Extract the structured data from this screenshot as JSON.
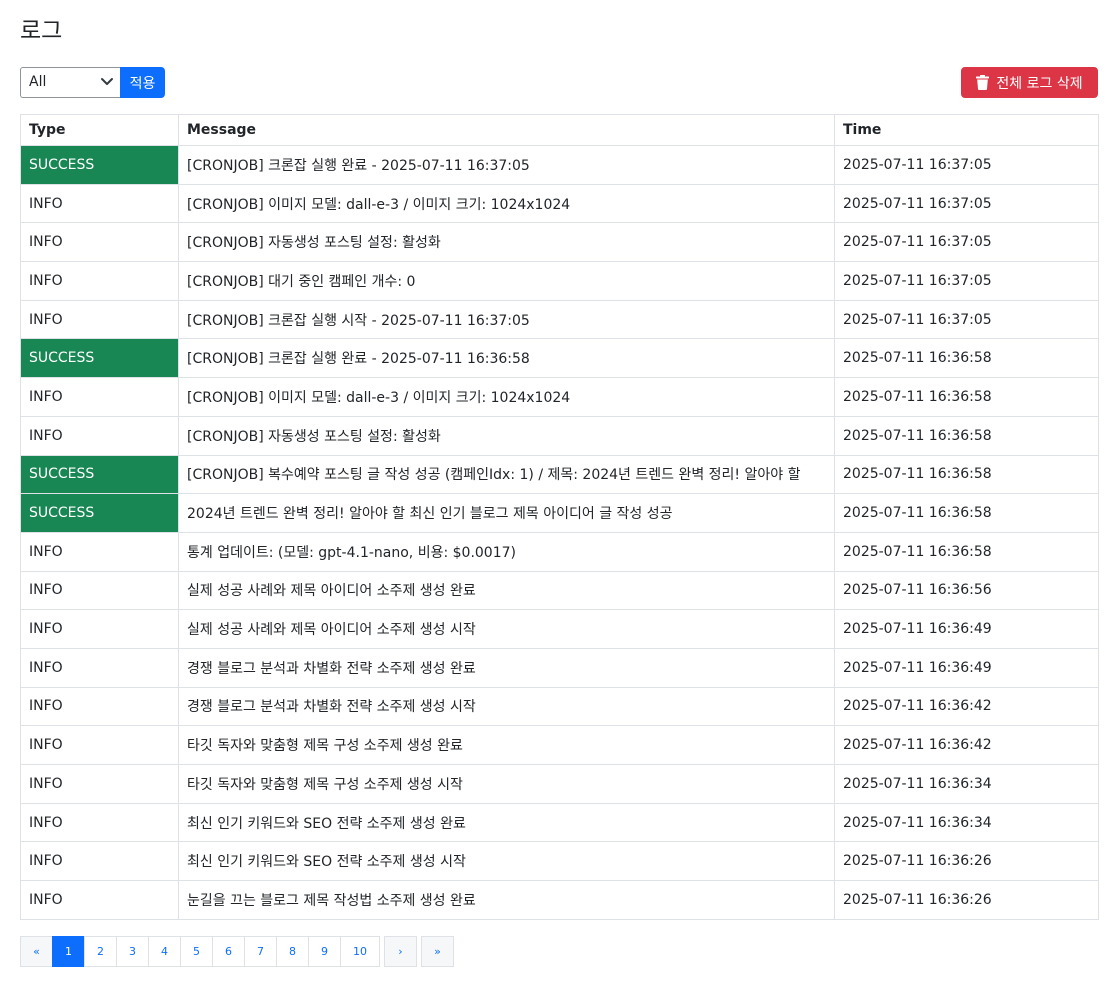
{
  "page": {
    "title": "로그"
  },
  "filter": {
    "selected": "All",
    "apply_label": "적용"
  },
  "actions": {
    "delete_all_label": "전체 로그 삭제",
    "delete_icon": "trash-icon"
  },
  "colors": {
    "primary": "#0d6efd",
    "danger": "#dc3545",
    "success": "#198754"
  },
  "table": {
    "headers": [
      "Type",
      "Message",
      "Time"
    ],
    "rows": [
      {
        "type": "SUCCESS",
        "message": "[CRONJOB] 크론잡 실행 완료 - 2025-07-11 16:37:05",
        "time": "2025-07-11 16:37:05"
      },
      {
        "type": "INFO",
        "message": "[CRONJOB] 이미지 모델: dall-e-3 / 이미지 크기: 1024x1024",
        "time": "2025-07-11 16:37:05"
      },
      {
        "type": "INFO",
        "message": "[CRONJOB] 자동생성 포스팅 설정: 활성화",
        "time": "2025-07-11 16:37:05"
      },
      {
        "type": "INFO",
        "message": "[CRONJOB] 대기 중인 캠페인 개수: 0",
        "time": "2025-07-11 16:37:05"
      },
      {
        "type": "INFO",
        "message": "[CRONJOB] 크론잡 실행 시작 - 2025-07-11 16:37:05",
        "time": "2025-07-11 16:37:05"
      },
      {
        "type": "SUCCESS",
        "message": "[CRONJOB] 크론잡 실행 완료 - 2025-07-11 16:36:58",
        "time": "2025-07-11 16:36:58"
      },
      {
        "type": "INFO",
        "message": "[CRONJOB] 이미지 모델: dall-e-3 / 이미지 크기: 1024x1024",
        "time": "2025-07-11 16:36:58"
      },
      {
        "type": "INFO",
        "message": "[CRONJOB] 자동생성 포스팅 설정: 활성화",
        "time": "2025-07-11 16:36:58"
      },
      {
        "type": "SUCCESS",
        "message": "[CRONJOB] 복수예약 포스팅 글 작성 성공 (캠페인Idx: 1) / 제목: 2024년 트렌드 완벽 정리! 알아야 할",
        "time": "2025-07-11 16:36:58"
      },
      {
        "type": "SUCCESS",
        "message": "2024년 트렌드 완벽 정리! 알아야 할 최신 인기 블로그 제목 아이디어 글 작성 성공",
        "time": "2025-07-11 16:36:58"
      },
      {
        "type": "INFO",
        "message": "통계 업데이트: (모델: gpt-4.1-nano, 비용: $0.0017)",
        "time": "2025-07-11 16:36:58"
      },
      {
        "type": "INFO",
        "message": "실제 성공 사례와 제목 아이디어 소주제 생성 완료",
        "time": "2025-07-11 16:36:56"
      },
      {
        "type": "INFO",
        "message": "실제 성공 사례와 제목 아이디어 소주제 생성 시작",
        "time": "2025-07-11 16:36:49"
      },
      {
        "type": "INFO",
        "message": "경쟁 블로그 분석과 차별화 전략 소주제 생성 완료",
        "time": "2025-07-11 16:36:49"
      },
      {
        "type": "INFO",
        "message": "경쟁 블로그 분석과 차별화 전략 소주제 생성 시작",
        "time": "2025-07-11 16:36:42"
      },
      {
        "type": "INFO",
        "message": "타깃 독자와 맞춤형 제목 구성 소주제 생성 완료",
        "time": "2025-07-11 16:36:42"
      },
      {
        "type": "INFO",
        "message": "타깃 독자와 맞춤형 제목 구성 소주제 생성 시작",
        "time": "2025-07-11 16:36:34"
      },
      {
        "type": "INFO",
        "message": "최신 인기 키워드와 SEO 전략 소주제 생성 완료",
        "time": "2025-07-11 16:36:34"
      },
      {
        "type": "INFO",
        "message": "최신 인기 키워드와 SEO 전략 소주제 생성 시작",
        "time": "2025-07-11 16:36:26"
      },
      {
        "type": "INFO",
        "message": "눈길을 끄는 블로그 제목 작성법 소주제 생성 완료",
        "time": "2025-07-11 16:36:26"
      }
    ]
  },
  "pagination": {
    "first_label": "«",
    "pages": [
      "1",
      "2",
      "3",
      "4",
      "5",
      "6",
      "7",
      "8",
      "9",
      "10"
    ],
    "current_page": "1",
    "next_label": "›",
    "last_label": "»"
  }
}
